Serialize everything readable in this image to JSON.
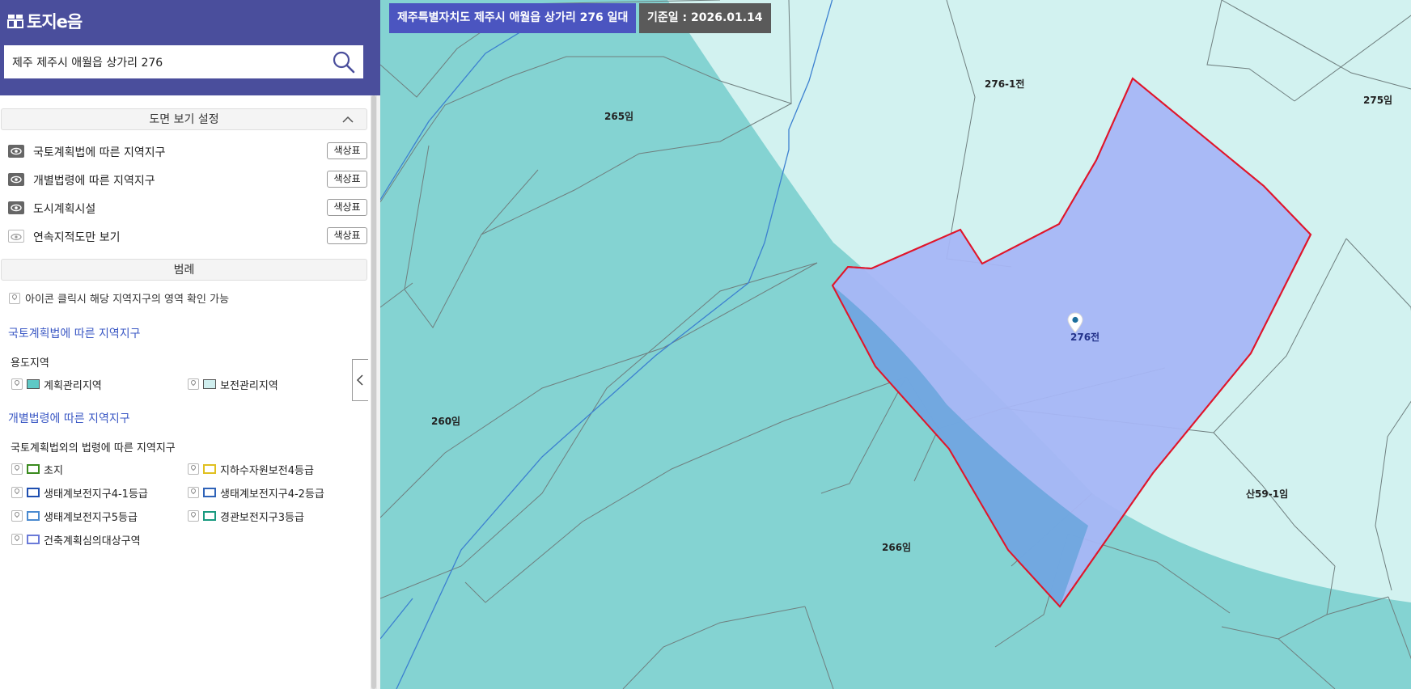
{
  "brand": {
    "logo_mark": "토지e음 logo mark",
    "name": "토지e음"
  },
  "search": {
    "value": "제주 제주시 애월읍 상가리 276",
    "icon": "search-icon"
  },
  "view_settings": {
    "title": "도면 보기 설정",
    "collapse_icon": "chevron-up-icon",
    "layers": [
      {
        "label": "국토계획법에 따른 지역지구",
        "visible": true,
        "button": "색상표"
      },
      {
        "label": "개별법령에 따른 지역지구",
        "visible": true,
        "button": "색상표"
      },
      {
        "label": "도시계획시설",
        "visible": true,
        "button": "색상표"
      },
      {
        "label": "연속지적도만 보기",
        "visible": false,
        "button": "색상표"
      }
    ]
  },
  "legend": {
    "title": "범례",
    "note": "아이콘 클릭시 해당 지역지구의 영역 확인 가능",
    "groups": [
      {
        "title": "국토계획법에 따른 지역지구",
        "subtitle": "용도지역",
        "items": [
          {
            "label": "계획관리지역",
            "fill": "#5fc9c6",
            "border": "#555555"
          },
          {
            "label": "보전관리지역",
            "fill": "#cfeeee",
            "border": "#555555"
          }
        ]
      },
      {
        "title": "개별법령에 따른 지역지구",
        "subtitle": "국토계획법외의 법령에 따른 지역지구",
        "items": [
          {
            "label": "초지",
            "fill": "none",
            "border": "#3a8a1e"
          },
          {
            "label": "지하수자원보전4등급",
            "fill": "none",
            "border": "#e0c020"
          },
          {
            "label": "생태계보전지구4-1등급",
            "fill": "none",
            "border": "#1f4fb0"
          },
          {
            "label": "생태계보전지구4-2등급",
            "fill": "none",
            "border": "#2f63b8"
          },
          {
            "label": "생태계보전지구5등급",
            "fill": "none",
            "border": "#4a8ad0"
          },
          {
            "label": "경관보전지구3등급",
            "fill": "none",
            "border": "#1a9a80"
          },
          {
            "label": "건축계획심의대상구역",
            "fill": "none",
            "border": "#6a7ad8"
          }
        ]
      }
    ]
  },
  "panel_toggle": {
    "icon": "chevron-left-icon"
  },
  "map": {
    "address_badge": "제주특별자치도 제주시 애월읍 상가리 276 일대",
    "date_badge": "기준일 : 2026.01.14",
    "selected_parcel": "276전",
    "parcel_labels": [
      "276-1전",
      "275임",
      "265임",
      "260임",
      "266임",
      "산59-1임"
    ],
    "colors": {
      "planned_mgmt": "#84d3d2",
      "conservation_mgmt": "#d2f2f0",
      "selection_fill": "#a6b6f6",
      "selection_border": "#e0162b",
      "ecology_line": "#3c80d0"
    }
  }
}
